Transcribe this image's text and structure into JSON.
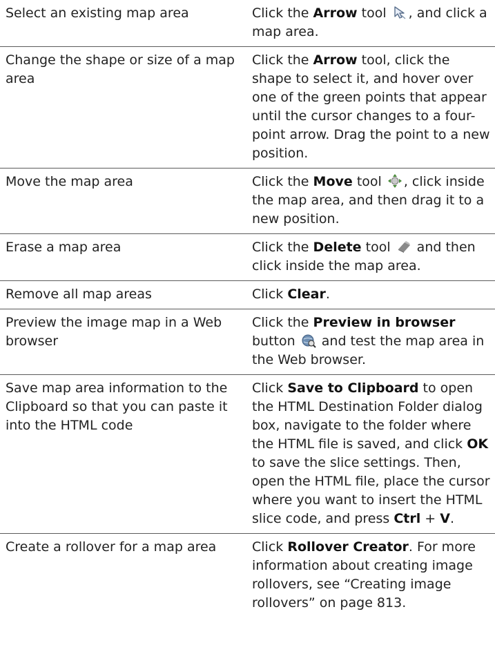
{
  "rows": [
    {
      "task": "Select an existing map area",
      "action": {
        "pre": "Click the ",
        "b1": "Arrow",
        "mid": " tool ",
        "icon": "arrow-tool-icon",
        "post": ", and click a map area."
      }
    },
    {
      "task": "Change the shape or size of a map area",
      "action": {
        "pre": "Click the ",
        "b1": "Arrow",
        "post": " tool, click the shape to select it, and hover over one of the green points that appear until the cursor changes to a four-point arrow. Drag the point to a new position."
      }
    },
    {
      "task": "Move the map area",
      "action": {
        "pre": "Click the ",
        "b1": "Move",
        "mid": " tool ",
        "icon": "move-tool-icon",
        "post": ", click inside the map area, and then drag it to a new position."
      }
    },
    {
      "task": "Erase a map area",
      "action": {
        "pre": "Click the ",
        "b1": "Delete",
        "mid": " tool ",
        "icon": "eraser-tool-icon",
        "post": " and then click inside the map area."
      }
    },
    {
      "task": "Remove all map areas",
      "action": {
        "pre": "Click ",
        "b1": "Clear",
        "post": "."
      }
    },
    {
      "task": "Preview the image map in a Web browser",
      "action": {
        "pre": "Click the ",
        "b1": "Preview in browser",
        "mid": " button ",
        "icon": "preview-browser-icon",
        "post": " and test the map area in the Web browser."
      }
    },
    {
      "task": "Save map area information to the Clipboard so that you can paste it into the HTML code",
      "action": {
        "pre": "Click ",
        "b1": "Save to Clipboard",
        "t2": " to open the HTML Destination Folder dialog box, navigate to the folder where the HTML file is saved, and click ",
        "b2": "OK",
        "t3": " to save the slice settings. Then, open the HTML file, place the cursor where you want to insert the HTML slice code, and press ",
        "b3": "Ctrl",
        "t4": " + ",
        "b4": "V",
        "post": "."
      }
    },
    {
      "task": "Create a rollover for a map area",
      "action": {
        "pre": "Click ",
        "b1": "Rollover Creator",
        "post": ". For more information about creating image rollovers, see “Creating image rollovers” on page 813."
      }
    }
  ]
}
